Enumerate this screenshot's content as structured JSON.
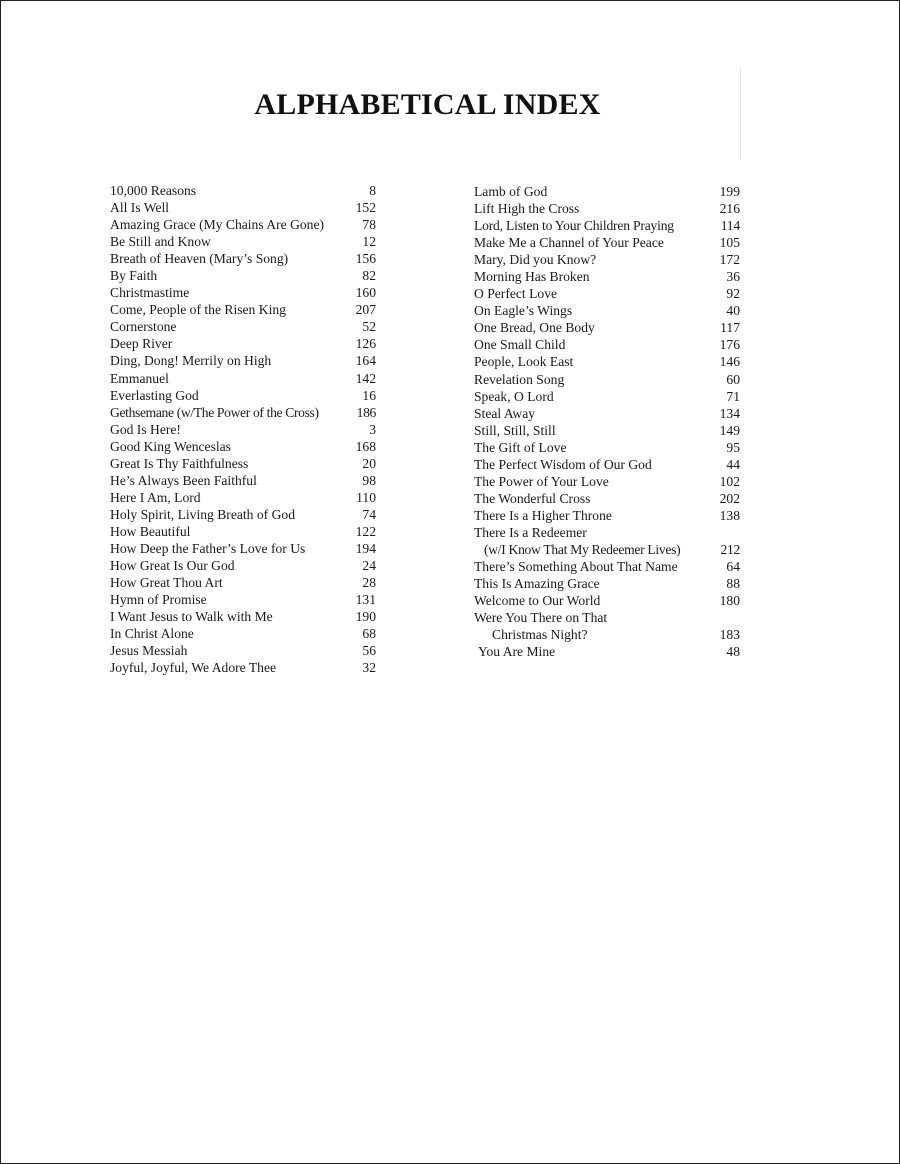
{
  "title": "ALPHABETICAL INDEX",
  "left_column": [
    {
      "title": "10,000 Reasons",
      "page": "8"
    },
    {
      "title": "All Is Well",
      "page": "152"
    },
    {
      "title": "Amazing Grace (My Chains Are Gone)",
      "page": "78"
    },
    {
      "title": "Be Still and Know",
      "page": "12"
    },
    {
      "title": "Breath of Heaven (Mary’s Song)",
      "page": "156"
    },
    {
      "title": "By Faith",
      "page": "82"
    },
    {
      "title": "Christmastime",
      "page": "160"
    },
    {
      "title": "Come, People of the Risen King",
      "page": "207"
    },
    {
      "title": "Cornerstone",
      "page": "52"
    },
    {
      "title": "Deep River",
      "page": "126"
    },
    {
      "title": "Ding, Dong! Merrily on High",
      "page": "164"
    },
    {
      "title": "Emmanuel",
      "page": "142"
    },
    {
      "title": "Everlasting God",
      "page": "16"
    },
    {
      "title": "Gethsemane (w/The Power of the Cross)",
      "page": "186"
    },
    {
      "title": "God Is Here!",
      "page": "3"
    },
    {
      "title": "Good King Wenceslas",
      "page": "168"
    },
    {
      "title": "Great Is Thy Faithfulness",
      "page": "20"
    },
    {
      "title": "He’s Always Been Faithful",
      "page": "98"
    },
    {
      "title": "Here I Am, Lord",
      "page": "110"
    },
    {
      "title": "Holy Spirit, Living Breath of God",
      "page": "74"
    },
    {
      "title": "How Beautiful",
      "page": "122"
    },
    {
      "title": "How Deep the Father’s Love for Us",
      "page": "194"
    },
    {
      "title": "How Great Is Our God",
      "page": "24"
    },
    {
      "title": "How Great Thou Art",
      "page": "28"
    },
    {
      "title": "Hymn of Promise",
      "page": "131"
    },
    {
      "title": "I Want Jesus to Walk with Me",
      "page": "190"
    },
    {
      "title": "In Christ Alone",
      "page": "68"
    },
    {
      "title": "Jesus Messiah",
      "page": "56"
    },
    {
      "title": "Joyful, Joyful, We Adore Thee",
      "page": "32"
    }
  ],
  "right_column": [
    {
      "title": "Lamb of God",
      "page": "199"
    },
    {
      "title": "Lift High the Cross",
      "page": "216"
    },
    {
      "title": "Lord, Listen to Your Children Praying",
      "page": "114"
    },
    {
      "title": "Make Me a Channel of Your Peace",
      "page": "105"
    },
    {
      "title": "Mary, Did you Know?",
      "page": "172"
    },
    {
      "title": "Morning Has Broken",
      "page": "36"
    },
    {
      "title": "O Perfect Love",
      "page": "92"
    },
    {
      "title": "On Eagle’s Wings",
      "page": "40"
    },
    {
      "title": "One Bread, One Body",
      "page": "117"
    },
    {
      "title": "One Small Child",
      "page": "176"
    },
    {
      "title": "People, Look East",
      "page": "146"
    },
    {
      "title": "Revelation Song",
      "page": "60"
    },
    {
      "title": "Speak, O Lord",
      "page": "71"
    },
    {
      "title": "Steal Away",
      "page": "134"
    },
    {
      "title": "Still, Still, Still",
      "page": "149"
    },
    {
      "title": "The Gift of Love",
      "page": "95"
    },
    {
      "title": "The Perfect Wisdom of Our God",
      "page": "44"
    },
    {
      "title": "The Power of Your Love",
      "page": "102"
    },
    {
      "title": "The Wonderful Cross",
      "page": "202"
    },
    {
      "title": "There Is a Higher Throne",
      "page": "138"
    },
    {
      "title": "There Is a Redeemer",
      "page": ""
    },
    {
      "title": "(w/I Know That My Redeemer Lives)",
      "page": "212"
    },
    {
      "title": "There’s Something About That Name",
      "page": "64"
    },
    {
      "title": "This Is Amazing Grace",
      "page": "88"
    },
    {
      "title": "Welcome to Our World",
      "page": "180"
    },
    {
      "title": "Were You There on That",
      "page": ""
    },
    {
      "title": "Christmas Night?",
      "page": "183"
    },
    {
      "title": "You Are Mine",
      "page": "48"
    }
  ]
}
